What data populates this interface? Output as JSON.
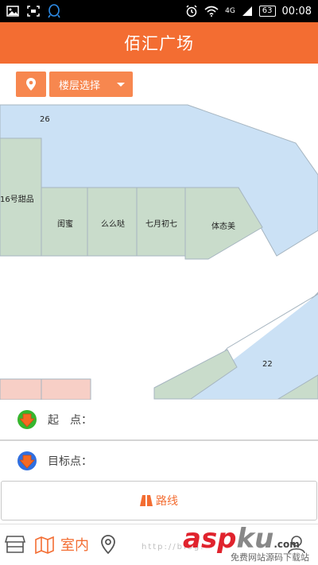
{
  "status_bar": {
    "battery": "63",
    "time": "00:08",
    "network": "4G"
  },
  "header": {
    "title": "佰汇广场"
  },
  "floor_selector": {
    "label": "楼层选择"
  },
  "map": {
    "shops": [
      {
        "name": "26"
      },
      {
        "name": "16号甜品"
      },
      {
        "name": "闺蜜"
      },
      {
        "name": "么么哒"
      },
      {
        "name": "七月初七"
      },
      {
        "name": "体态美"
      },
      {
        "name": "22"
      }
    ],
    "colors": {
      "corridor": "#cbe1f5",
      "shop": "#c9dccb",
      "shop_pink": "#f7cfc6",
      "border": "#a6b5c0"
    }
  },
  "route_panel": {
    "start_label": "起　点：",
    "end_label": "目标点：",
    "route_button": "路线"
  },
  "bottom_nav": {
    "indoor_label": "室内",
    "watermark": "http://blog.",
    "brand_a": "asp",
    "brand_b": "ku",
    "brand_suffix": ".com",
    "brand_sub": "免费网站源码下载站"
  },
  "colors": {
    "accent": "#f36d32",
    "accent_light": "#f7874f"
  }
}
